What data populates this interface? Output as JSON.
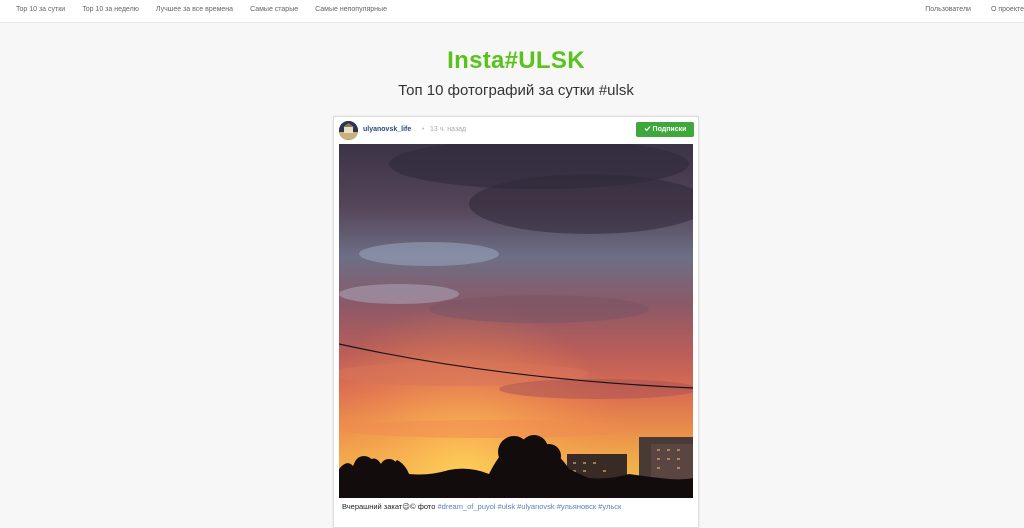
{
  "nav": {
    "left": [
      "Top 10 за сутки",
      "Top 10 за неделю",
      "Лучшее за все времена",
      "Самые старые",
      "Самые непопулярные"
    ],
    "right": [
      "Пользователи",
      "О проекте"
    ]
  },
  "site_title": "Insta#ULSK",
  "subtitle": "Топ 10 фотографий за сутки #ulsk",
  "post": {
    "username": "ulyanovsk_life",
    "separator": "•",
    "time": "13 ч. назад",
    "subscribe_label": "Подписки",
    "caption_text": "Вчерашний закат😉© фото ",
    "caption_tags": "#dream_of_puyol #ulsk #ulyanovsk #ульяновск #ульск"
  },
  "colors": {
    "accent": "#59c31c",
    "button": "#3fa83b",
    "link": "#5b7fbf"
  }
}
